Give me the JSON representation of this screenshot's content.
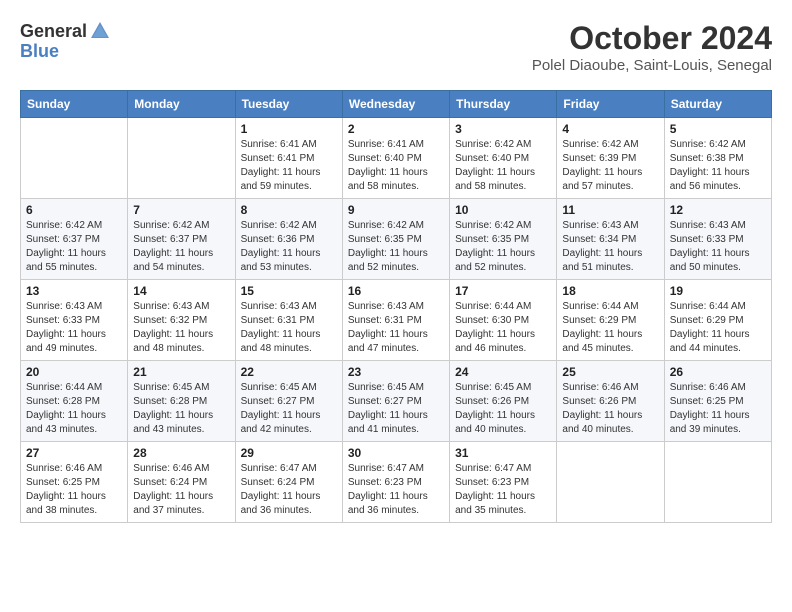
{
  "header": {
    "logo": {
      "text_general": "General",
      "text_blue": "Blue"
    },
    "title": "October 2024",
    "subtitle": "Polel Diaoube, Saint-Louis, Senegal"
  },
  "days_of_week": [
    "Sunday",
    "Monday",
    "Tuesday",
    "Wednesday",
    "Thursday",
    "Friday",
    "Saturday"
  ],
  "weeks": [
    [
      {
        "day": "",
        "info": ""
      },
      {
        "day": "",
        "info": ""
      },
      {
        "day": "1",
        "info": "Sunrise: 6:41 AM\nSunset: 6:41 PM\nDaylight: 11 hours and 59 minutes."
      },
      {
        "day": "2",
        "info": "Sunrise: 6:41 AM\nSunset: 6:40 PM\nDaylight: 11 hours and 58 minutes."
      },
      {
        "day": "3",
        "info": "Sunrise: 6:42 AM\nSunset: 6:40 PM\nDaylight: 11 hours and 58 minutes."
      },
      {
        "day": "4",
        "info": "Sunrise: 6:42 AM\nSunset: 6:39 PM\nDaylight: 11 hours and 57 minutes."
      },
      {
        "day": "5",
        "info": "Sunrise: 6:42 AM\nSunset: 6:38 PM\nDaylight: 11 hours and 56 minutes."
      }
    ],
    [
      {
        "day": "6",
        "info": "Sunrise: 6:42 AM\nSunset: 6:37 PM\nDaylight: 11 hours and 55 minutes."
      },
      {
        "day": "7",
        "info": "Sunrise: 6:42 AM\nSunset: 6:37 PM\nDaylight: 11 hours and 54 minutes."
      },
      {
        "day": "8",
        "info": "Sunrise: 6:42 AM\nSunset: 6:36 PM\nDaylight: 11 hours and 53 minutes."
      },
      {
        "day": "9",
        "info": "Sunrise: 6:42 AM\nSunset: 6:35 PM\nDaylight: 11 hours and 52 minutes."
      },
      {
        "day": "10",
        "info": "Sunrise: 6:42 AM\nSunset: 6:35 PM\nDaylight: 11 hours and 52 minutes."
      },
      {
        "day": "11",
        "info": "Sunrise: 6:43 AM\nSunset: 6:34 PM\nDaylight: 11 hours and 51 minutes."
      },
      {
        "day": "12",
        "info": "Sunrise: 6:43 AM\nSunset: 6:33 PM\nDaylight: 11 hours and 50 minutes."
      }
    ],
    [
      {
        "day": "13",
        "info": "Sunrise: 6:43 AM\nSunset: 6:33 PM\nDaylight: 11 hours and 49 minutes."
      },
      {
        "day": "14",
        "info": "Sunrise: 6:43 AM\nSunset: 6:32 PM\nDaylight: 11 hours and 48 minutes."
      },
      {
        "day": "15",
        "info": "Sunrise: 6:43 AM\nSunset: 6:31 PM\nDaylight: 11 hours and 48 minutes."
      },
      {
        "day": "16",
        "info": "Sunrise: 6:43 AM\nSunset: 6:31 PM\nDaylight: 11 hours and 47 minutes."
      },
      {
        "day": "17",
        "info": "Sunrise: 6:44 AM\nSunset: 6:30 PM\nDaylight: 11 hours and 46 minutes."
      },
      {
        "day": "18",
        "info": "Sunrise: 6:44 AM\nSunset: 6:29 PM\nDaylight: 11 hours and 45 minutes."
      },
      {
        "day": "19",
        "info": "Sunrise: 6:44 AM\nSunset: 6:29 PM\nDaylight: 11 hours and 44 minutes."
      }
    ],
    [
      {
        "day": "20",
        "info": "Sunrise: 6:44 AM\nSunset: 6:28 PM\nDaylight: 11 hours and 43 minutes."
      },
      {
        "day": "21",
        "info": "Sunrise: 6:45 AM\nSunset: 6:28 PM\nDaylight: 11 hours and 43 minutes."
      },
      {
        "day": "22",
        "info": "Sunrise: 6:45 AM\nSunset: 6:27 PM\nDaylight: 11 hours and 42 minutes."
      },
      {
        "day": "23",
        "info": "Sunrise: 6:45 AM\nSunset: 6:27 PM\nDaylight: 11 hours and 41 minutes."
      },
      {
        "day": "24",
        "info": "Sunrise: 6:45 AM\nSunset: 6:26 PM\nDaylight: 11 hours and 40 minutes."
      },
      {
        "day": "25",
        "info": "Sunrise: 6:46 AM\nSunset: 6:26 PM\nDaylight: 11 hours and 40 minutes."
      },
      {
        "day": "26",
        "info": "Sunrise: 6:46 AM\nSunset: 6:25 PM\nDaylight: 11 hours and 39 minutes."
      }
    ],
    [
      {
        "day": "27",
        "info": "Sunrise: 6:46 AM\nSunset: 6:25 PM\nDaylight: 11 hours and 38 minutes."
      },
      {
        "day": "28",
        "info": "Sunrise: 6:46 AM\nSunset: 6:24 PM\nDaylight: 11 hours and 37 minutes."
      },
      {
        "day": "29",
        "info": "Sunrise: 6:47 AM\nSunset: 6:24 PM\nDaylight: 11 hours and 36 minutes."
      },
      {
        "day": "30",
        "info": "Sunrise: 6:47 AM\nSunset: 6:23 PM\nDaylight: 11 hours and 36 minutes."
      },
      {
        "day": "31",
        "info": "Sunrise: 6:47 AM\nSunset: 6:23 PM\nDaylight: 11 hours and 35 minutes."
      },
      {
        "day": "",
        "info": ""
      },
      {
        "day": "",
        "info": ""
      }
    ]
  ]
}
